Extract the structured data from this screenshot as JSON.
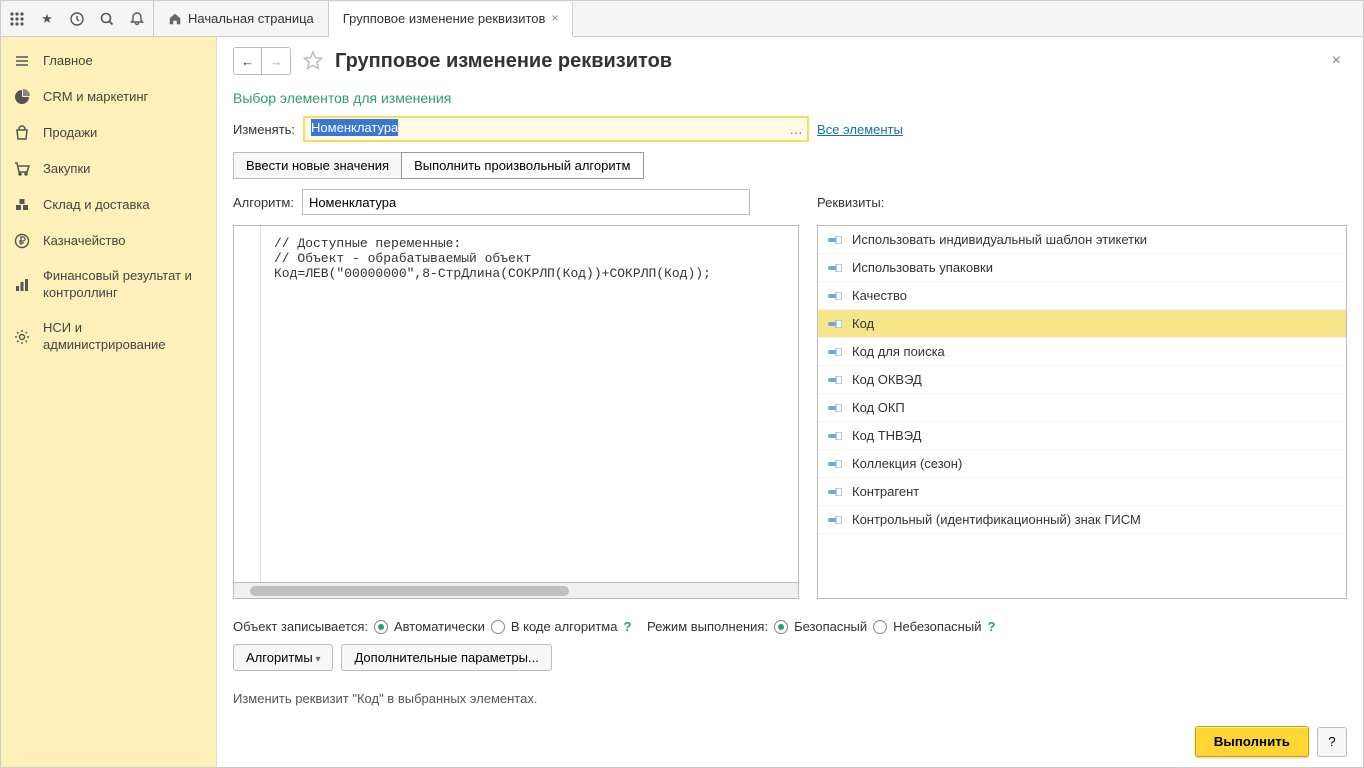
{
  "tabs": {
    "home": "Начальная страница",
    "active": "Групповое изменение реквизитов"
  },
  "sidebar": {
    "items": [
      {
        "label": "Главное"
      },
      {
        "label": "CRM и маркетинг"
      },
      {
        "label": "Продажи"
      },
      {
        "label": "Закупки"
      },
      {
        "label": "Склад и доставка"
      },
      {
        "label": "Казначейство"
      },
      {
        "label": "Финансовый результат и контроллинг"
      },
      {
        "label": "НСИ и администрирование"
      }
    ]
  },
  "page": {
    "title": "Групповое изменение реквизитов",
    "section": "Выбор элементов для изменения",
    "change_label": "Изменять:",
    "change_value": "Номенклатура",
    "all_elements": "Все элементы",
    "tab_new_values": "Ввести новые значения",
    "tab_algorithm": "Выполнить произвольный алгоритм",
    "algorithm_label": "Алгоритм:",
    "algorithm_value": "Номенклатура",
    "requisites_label": "Реквизиты:",
    "code": "// Доступные переменные:\n// Объект - обрабатываемый объект\nКод=ЛЕВ(\"00000000\",8-СтрДлина(СОКРЛП(Код))+СОКРЛП(Код));",
    "attributes": [
      "Использовать индивидуальный шаблон этикетки",
      "Использовать упаковки",
      "Качество",
      "Код",
      "Код для поиска",
      "Код ОКВЭД",
      "Код ОКП",
      "Код ТНВЭД",
      "Коллекция (сезон)",
      "Контрагент",
      "Контрольный (идентификационный) знак ГИСМ"
    ],
    "selected_attr_index": 3,
    "save_label": "Объект записывается:",
    "save_auto": "Автоматически",
    "save_in_code": "В коде алгоритма",
    "mode_label": "Режим выполнения:",
    "mode_safe": "Безопасный",
    "mode_unsafe": "Небезопасный",
    "algorithms_btn": "Алгоритмы",
    "extra_params_btn": "Дополнительные параметры...",
    "status": "Изменить реквизит \"Код\" в выбранных элементах.",
    "execute_btn": "Выполнить"
  }
}
